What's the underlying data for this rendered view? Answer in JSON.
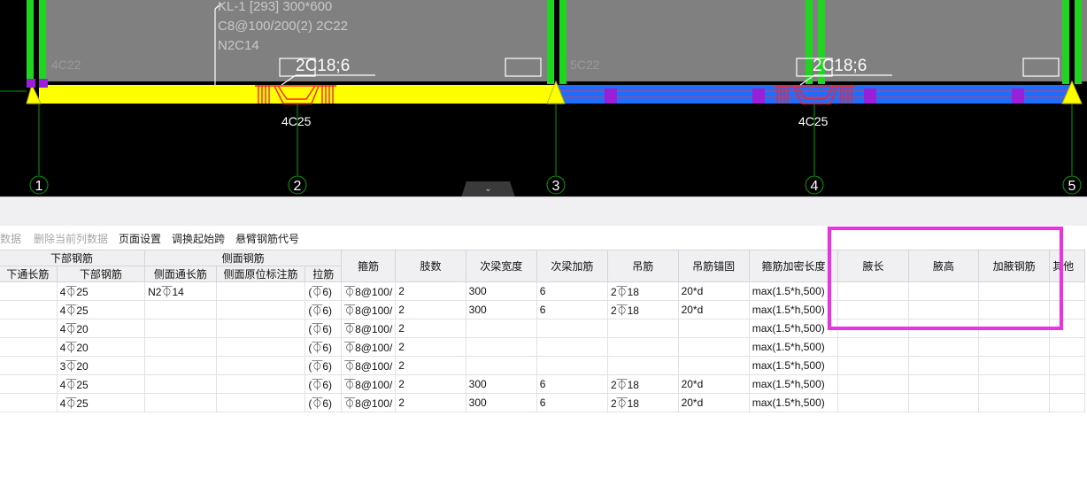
{
  "cad": {
    "beam_label": "KL-1 [293] 300*600",
    "beam_stirrup": "C8@100/200(2) 2C22",
    "beam_side": "N2C14",
    "span1_top": "4C22",
    "span1_support_bar": "2C18;6",
    "span1_bottom": "4C25",
    "span2_top": "5C22",
    "span2_support_bar": "2C18;6",
    "span2_bottom": "4C25",
    "axes": [
      "1",
      "2",
      "3",
      "4",
      "5"
    ],
    "colors": {
      "beam_selected": "#ffff00",
      "beam_normal": "#1e6dff",
      "column": "#22d422",
      "wall": "#808080",
      "axis": "#00a000",
      "highlight": "#ee2fe6"
    },
    "collapse_icon": "chevron-down-icon"
  },
  "toolbar": {
    "copy_data": "数据",
    "delete_column": "删除当前列数据",
    "page_setup": "页面设置",
    "swap_start_span": "调换起始跨",
    "cantilever_code": "悬臂钢筋代号"
  },
  "grid": {
    "group_headers": {
      "bottom": "下部钢筋",
      "side": "侧面钢筋"
    },
    "headers": {
      "bottom_through": "下通长筋",
      "bottom_bar": "下部钢筋",
      "side_through": "侧面通长筋",
      "side_original": "侧面原位标注筋",
      "tie": "拉筋",
      "stirrup": "箍筋",
      "legs": "肢数",
      "sec_width": "次梁宽度",
      "sec_add": "次梁加筋",
      "hanger": "吊筋",
      "hanger_anchor": "吊筋锚固",
      "dense_length": "箍筋加密长度",
      "haunch_length": "腋长",
      "haunch_height": "腋高",
      "haunch_bar": "加腋钢筋",
      "other": "其他"
    },
    "rows": [
      {
        "bottom_through": "",
        "bottom_bar": "4⏁25",
        "side_through": "N2⏁14",
        "side_original": "",
        "tie": "(⏁6)",
        "stirrup": "⏁8@100/",
        "legs": "2",
        "sec_width": "300",
        "sec_add": "6",
        "hanger": "2⏁18",
        "hanger_anchor": "20*d",
        "dense_length": "max(1.5*h,500)",
        "haunch_length": "",
        "haunch_height": "",
        "haunch_bar": "",
        "other": ""
      },
      {
        "bottom_through": "",
        "bottom_bar": "4⏁25",
        "side_through": "",
        "side_original": "",
        "tie": "(⏁6)",
        "stirrup": "⏁8@100/",
        "legs": "2",
        "sec_width": "300",
        "sec_add": "6",
        "hanger": "2⏁18",
        "hanger_anchor": "20*d",
        "dense_length": "max(1.5*h,500)",
        "haunch_length": "",
        "haunch_height": "",
        "haunch_bar": "",
        "other": ""
      },
      {
        "bottom_through": "",
        "bottom_bar": "4⏁20",
        "side_through": "",
        "side_original": "",
        "tie": "(⏁6)",
        "stirrup": "⏁8@100/",
        "legs": "2",
        "sec_width": "",
        "sec_add": "",
        "hanger": "",
        "hanger_anchor": "",
        "dense_length": "max(1.5*h,500)",
        "haunch_length": "",
        "haunch_height": "",
        "haunch_bar": "",
        "other": ""
      },
      {
        "bottom_through": "",
        "bottom_bar": "4⏁20",
        "side_through": "",
        "side_original": "",
        "tie": "(⏁6)",
        "stirrup": "⏁8@100/",
        "legs": "2",
        "sec_width": "",
        "sec_add": "",
        "hanger": "",
        "hanger_anchor": "",
        "dense_length": "max(1.5*h,500)",
        "haunch_length": "",
        "haunch_height": "",
        "haunch_bar": "",
        "other": ""
      },
      {
        "bottom_through": "",
        "bottom_bar": "3⏁20",
        "side_through": "",
        "side_original": "",
        "tie": "(⏁6)",
        "stirrup": "⏁8@100/",
        "legs": "2",
        "sec_width": "",
        "sec_add": "",
        "hanger": "",
        "hanger_anchor": "",
        "dense_length": "max(1.5*h,500)",
        "haunch_length": "",
        "haunch_height": "",
        "haunch_bar": "",
        "other": ""
      },
      {
        "bottom_through": "",
        "bottom_bar": "4⏁25",
        "side_through": "",
        "side_original": "",
        "tie": "(⏁6)",
        "stirrup": "⏁8@100/",
        "legs": "2",
        "sec_width": "300",
        "sec_add": "6",
        "hanger": "2⏁18",
        "hanger_anchor": "20*d",
        "dense_length": "max(1.5*h,500)",
        "haunch_length": "",
        "haunch_height": "",
        "haunch_bar": "",
        "other": ""
      },
      {
        "bottom_through": "",
        "bottom_bar": "4⏁25",
        "side_through": "",
        "side_original": "",
        "tie": "(⏁6)",
        "stirrup": "⏁8@100/",
        "legs": "2",
        "sec_width": "300",
        "sec_add": "6",
        "hanger": "2⏁18",
        "hanger_anchor": "20*d",
        "dense_length": "max(1.5*h,500)",
        "haunch_length": "",
        "haunch_height": "",
        "haunch_bar": "",
        "other": ""
      }
    ]
  }
}
